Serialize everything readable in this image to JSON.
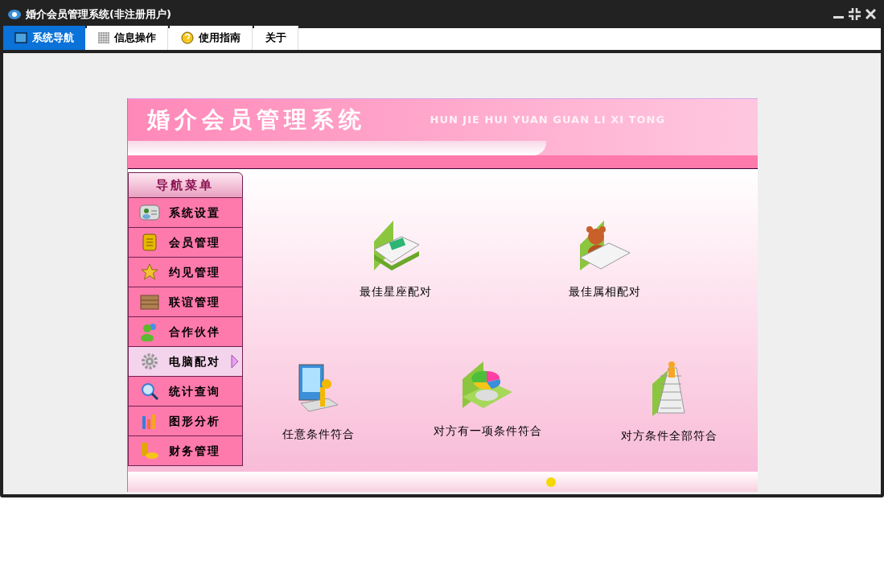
{
  "window": {
    "title": "婚介会员管理系统(非注册用户)"
  },
  "tabs": [
    {
      "label": "系统导航",
      "selected": true
    },
    {
      "label": "信息操作",
      "selected": false
    },
    {
      "label": "使用指南",
      "selected": false
    },
    {
      "label": "关于",
      "selected": false
    }
  ],
  "banner": {
    "title": "婚介会员管理系统",
    "pinyin": "HUN JIE HUI YUAN GUAN LI XI TONG"
  },
  "nav": {
    "title": "导航菜单",
    "items": [
      {
        "label": "系统设置",
        "selected": false
      },
      {
        "label": "会员管理",
        "selected": false
      },
      {
        "label": "约见管理",
        "selected": false
      },
      {
        "label": "联谊管理",
        "selected": false
      },
      {
        "label": "合作伙伴",
        "selected": false
      },
      {
        "label": "电脑配对",
        "selected": true
      },
      {
        "label": "统计查询",
        "selected": false
      },
      {
        "label": "图形分析",
        "selected": false
      },
      {
        "label": "财务管理",
        "selected": false
      }
    ]
  },
  "features": [
    {
      "label": "最佳星座配对"
    },
    {
      "label": "最佳属相配对"
    },
    {
      "label": "任意条件符合"
    },
    {
      "label": "对方有一项条件符合"
    },
    {
      "label": "对方条件全部符合"
    }
  ]
}
